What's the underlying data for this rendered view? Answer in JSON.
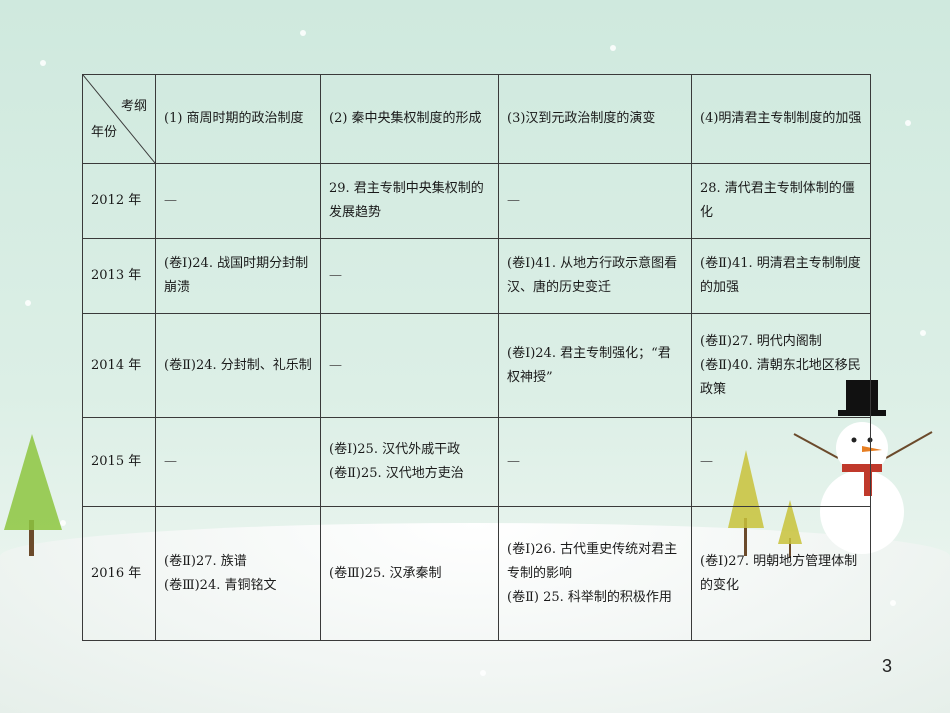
{
  "table": {
    "corner_top": "考纲",
    "corner_bottom": "年份",
    "headers": [
      "(1) 商周时期的政治制度",
      "(2) 秦中央集权制度的形成",
      "(3)汉到元政治制度的演变",
      "(4)明清君主专制制度的加强"
    ],
    "rows": [
      {
        "year": "2012 年",
        "cells": [
          "—",
          "29. 君主专制中央集权制的发展趋势",
          "—",
          "28. 清代君主专制体制的僵化"
        ]
      },
      {
        "year": "2013 年",
        "cells": [
          "(卷Ⅰ)24. 战国时期分封制崩溃",
          "—",
          "(卷Ⅰ)41. 从地方行政示意图看汉、唐的历史变迁",
          "(卷Ⅱ)41. 明清君主专制制度的加强"
        ]
      },
      {
        "year": "2014 年",
        "cells": [
          "(卷Ⅱ)24. 分封制、礼乐制",
          "—",
          "(卷Ⅰ)24. 君主专制强化；“君权神授”",
          "(卷Ⅱ)27. 明代内阁制\n(卷Ⅱ)40. 清朝东北地区移民政策"
        ]
      },
      {
        "year": "2015 年",
        "cells": [
          "—",
          "(卷Ⅰ)25. 汉代外戚干政\n(卷Ⅱ)25. 汉代地方吏治",
          "—",
          "—"
        ]
      },
      {
        "year": "2016 年",
        "cells": [
          "(卷Ⅱ)27. 族谱\n(卷Ⅲ)24. 青铜铭文",
          "(卷Ⅲ)25. 汉承秦制",
          "(卷Ⅰ)26. 古代重史传统对君主专制的影响\n(卷Ⅱ) 25. 科举制的积极作用",
          "(卷Ⅰ)27. 明朝地方管理体制的变化"
        ]
      }
    ]
  },
  "page_number": "3",
  "colors": {
    "background": "#d5ece2",
    "border": "#3a3a3a",
    "tree": "#8dc63f",
    "hat": "#111111",
    "scarf": "#c0392b"
  }
}
